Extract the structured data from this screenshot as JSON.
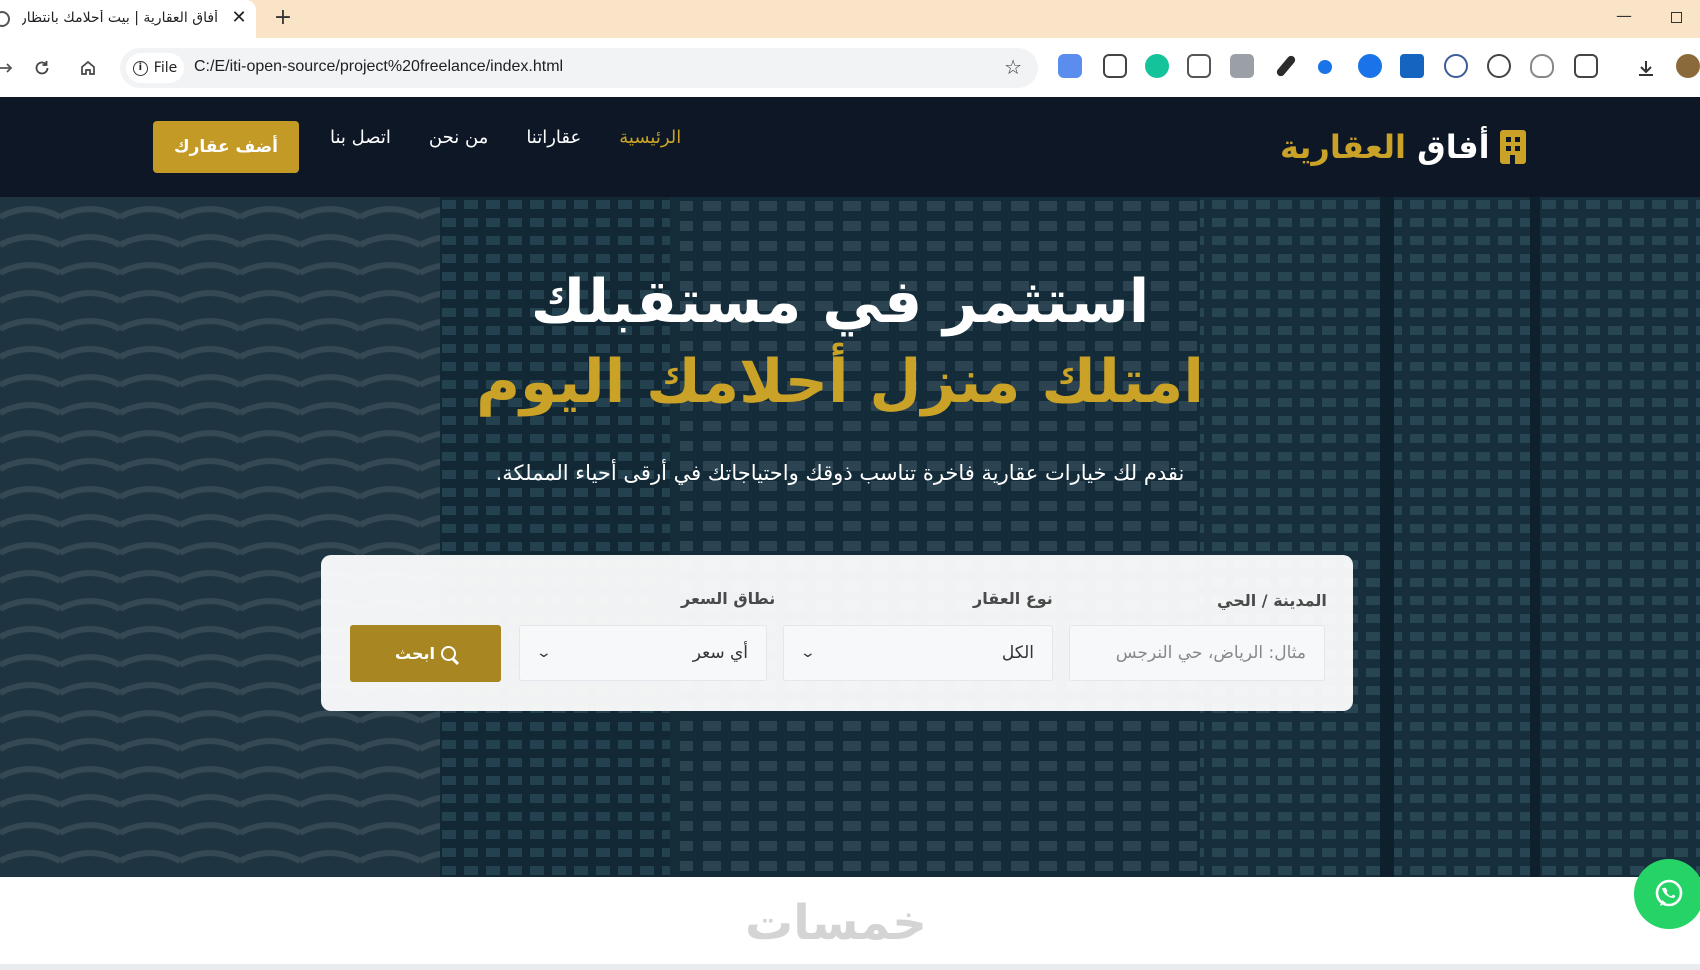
{
  "browser": {
    "tab_title": "أفاق العقارية | بيت أحلامك بانتظار",
    "close_glyph": "✕",
    "new_tab_glyph": "+",
    "minimize_glyph": "—",
    "site_chip_label": "File",
    "url": "C:/E/iti-open-source/project%20freelance/index.html",
    "extension_icons": [
      "translate-icon",
      "cast-icon",
      "grammarly-icon",
      "table-icon",
      "camera-icon",
      "pen-icon",
      "dot-icon",
      "pause-icon",
      "m-icon",
      "search-ext-icon",
      "rocket-icon",
      "shield-icon",
      "puzzle-icon",
      "download-icon",
      "profile-avatar"
    ]
  },
  "site": {
    "logo_white": "أفاق",
    "logo_gold": "العقارية",
    "nav": [
      {
        "label": "الرئيسية",
        "active": true
      },
      {
        "label": "عقاراتنا",
        "active": false
      },
      {
        "label": "من نحن",
        "active": false
      },
      {
        "label": "اتصل بنا",
        "active": false
      }
    ],
    "add_property_label": "أضف عقارك",
    "colors": {
      "navy": "#0d1726",
      "gold": "#c9a227",
      "whatsapp": "#25d366"
    }
  },
  "hero": {
    "title_line1": "استثمر في مستقبلك",
    "title_line2": "امتلك منزل أحلامك اليوم",
    "subtitle": "نقدم لك خيارات عقارية فاخرة تناسب ذوقك واحتياجاتك في أرقى أحياء المملكة."
  },
  "search": {
    "city_label": "المدينة / الحي",
    "city_placeholder": "مثال: الرياض، حي النرجس",
    "type_label": "نوع العقار",
    "type_value": "الكل",
    "price_label": "نطاق السعر",
    "price_value": "أي سعر",
    "button_label": "ابحث"
  },
  "watermark": "خمسات"
}
